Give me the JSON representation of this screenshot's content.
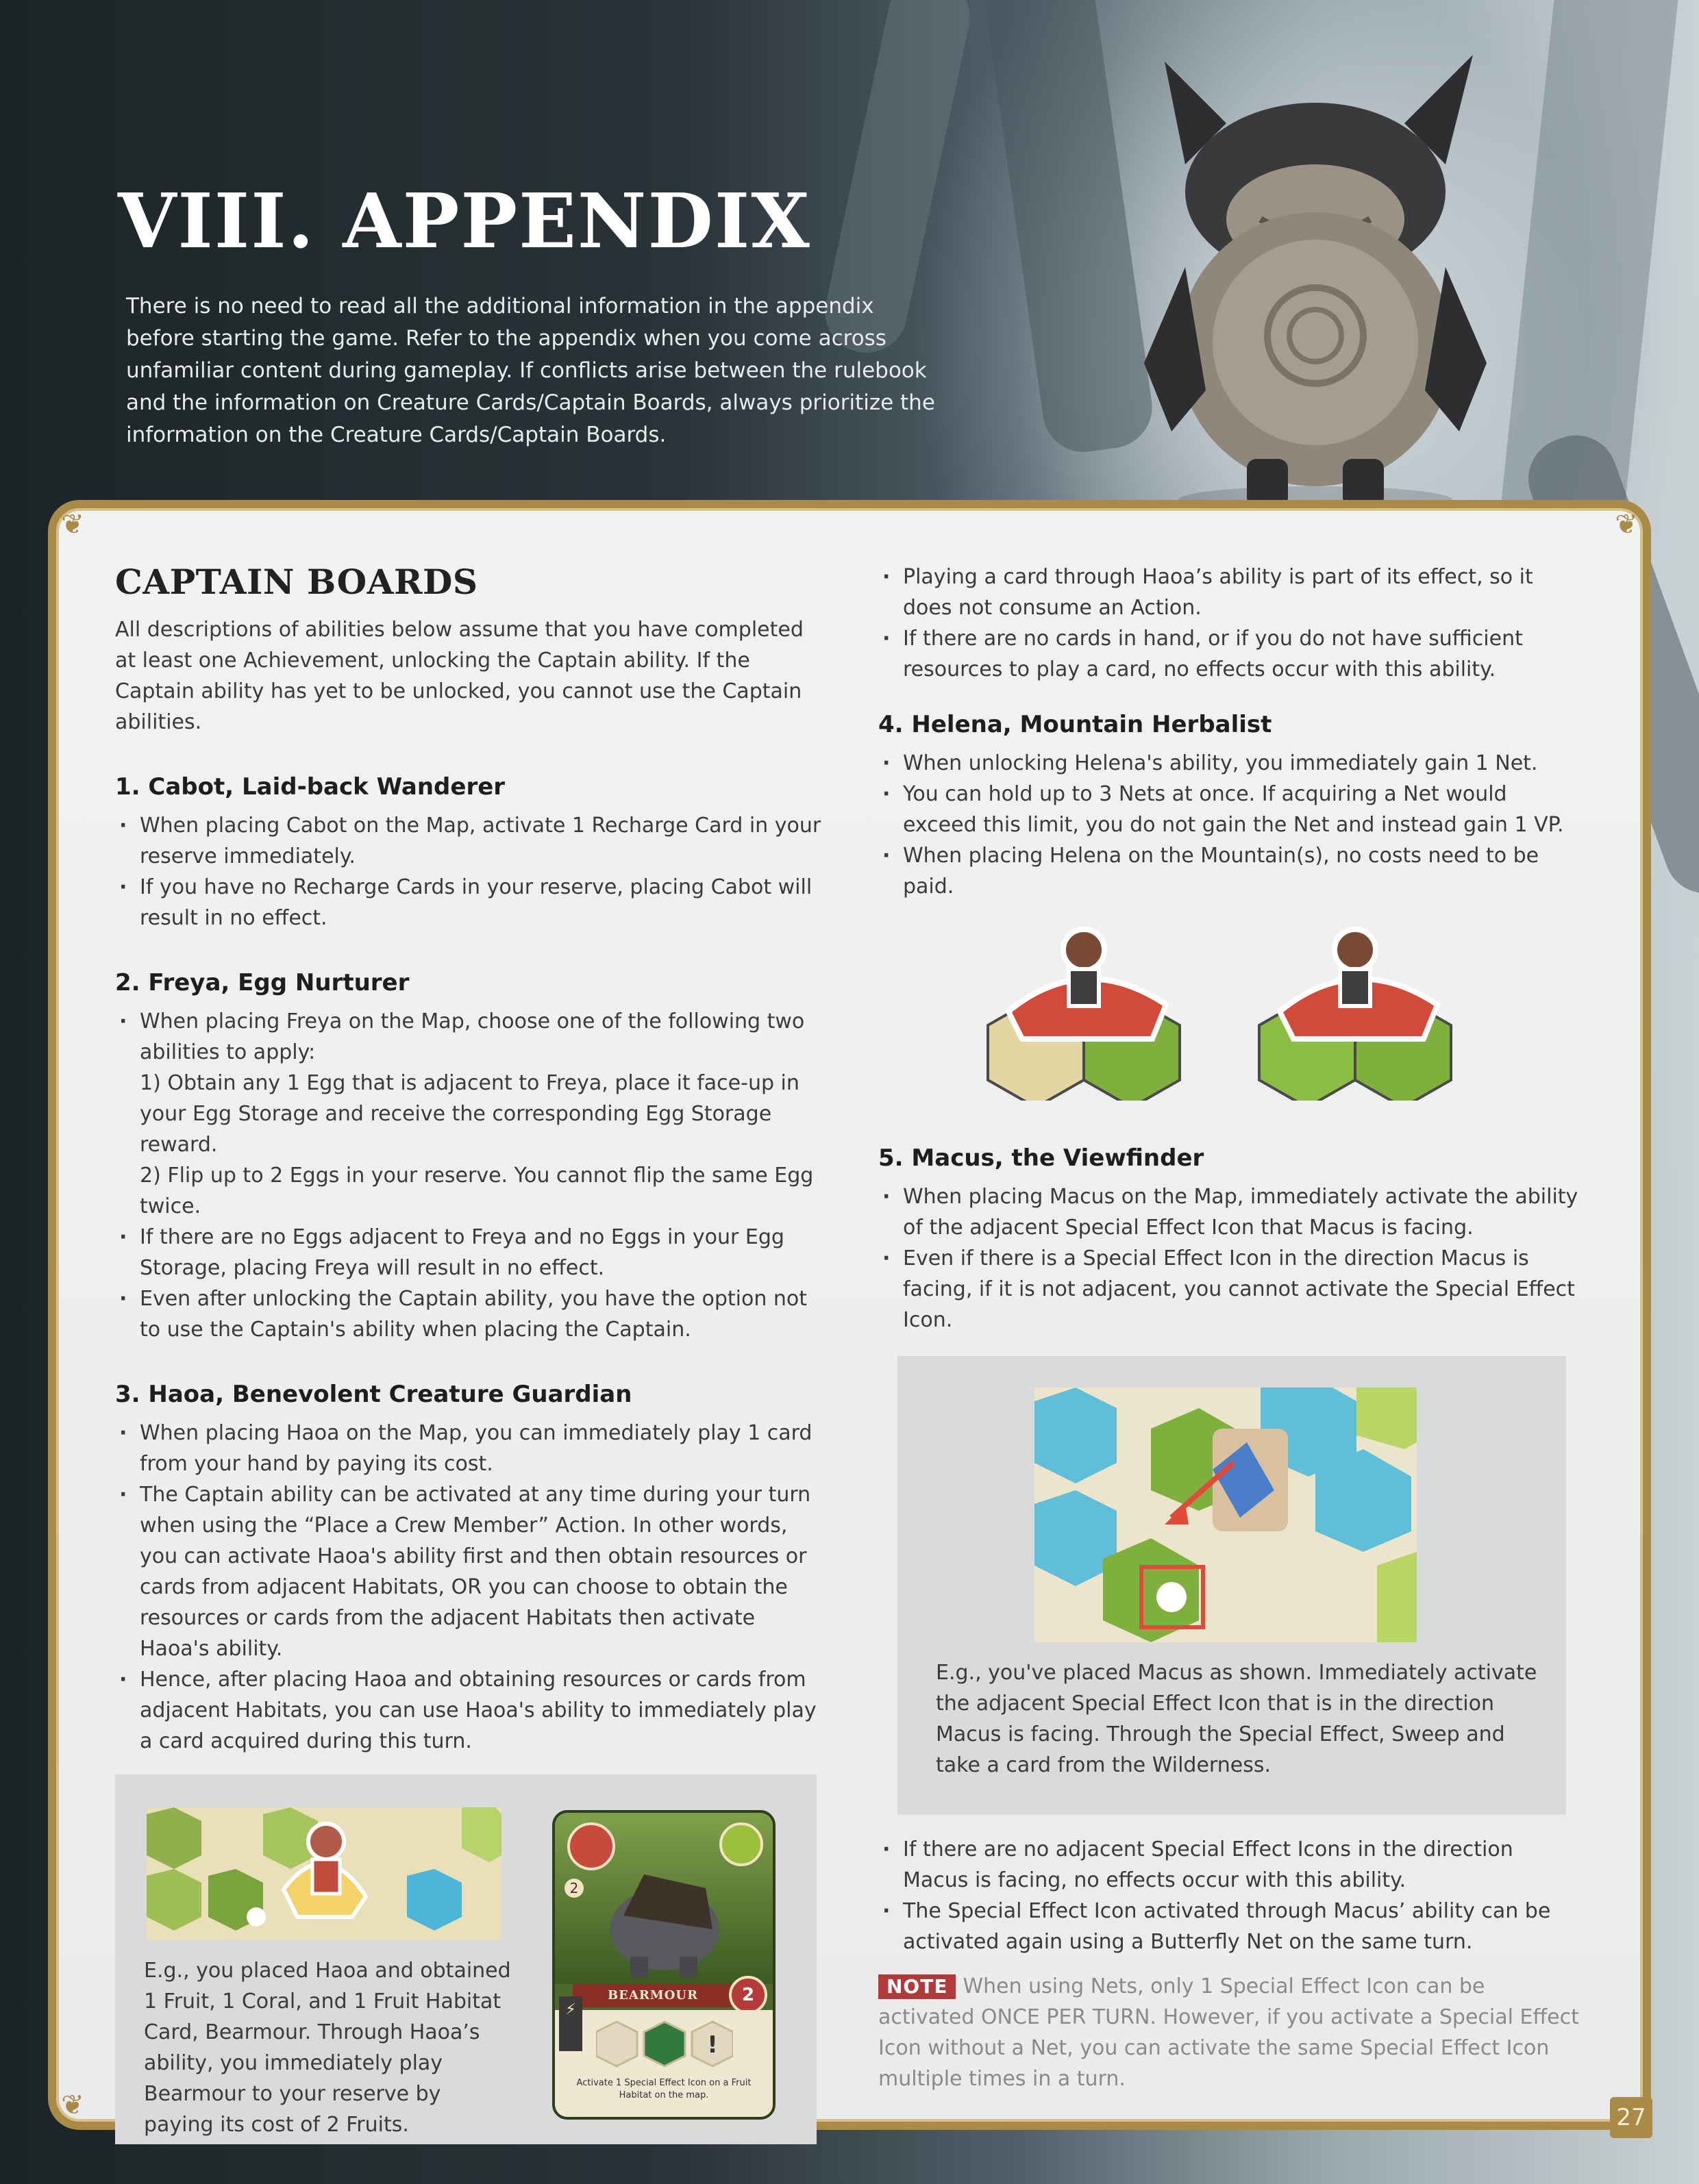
{
  "header": {
    "title": "VIII. APPENDIX",
    "intro": "There is no need to read all the additional information in the appendix before starting the game. Refer to the appendix when you come across unfamiliar content during gameplay. If conflicts arise between the rulebook and the information on Creature Cards/Captain Boards, always prioritize the information on the Creature Cards/Captain Boards."
  },
  "section": {
    "title": "CAPTAIN BOARDS",
    "lead": "All descriptions of abilities below assume that you have completed at least one Achievement, unlocking the Captain ability. If the Captain ability has yet to be unlocked, you cannot use the Captain abilities."
  },
  "captains": [
    {
      "title": "1. Cabot, Laid-back Wanderer",
      "bullets": [
        "When placing Cabot on the Map, activate 1 Recharge Card in your reserve immediately.",
        "If you have no Recharge Cards in your reserve, placing Cabot will result in no effect."
      ]
    },
    {
      "title": "2. Freya, Egg Nurturer",
      "bullets": [
        "When placing Freya on the Map, choose one of the following two abilities to apply:",
        "If there are no Eggs adjacent to Freya and no Eggs in your Egg Storage, placing Freya will result in no effect.",
        "Even after unlocking the Captain ability, you have the option not to use the Captain's ability when placing the Captain."
      ],
      "sub_items": [
        "1) Obtain any 1 Egg that is adjacent to Freya, place it face-up in your Egg Storage and receive the corresponding Egg Storage reward.",
        "2) Flip up to 2 Eggs in your reserve. You cannot flip the same Egg twice."
      ]
    },
    {
      "title": "3. Haoa, Benevolent Creature Guardian",
      "bullets": [
        "When placing Haoa on the Map, you can immediately play 1 card from your hand by paying its cost.",
        "The Captain ability can be activated at any time during your turn when using the “Place a Crew Member” Action. In other words, you can activate Haoa's ability first and then obtain resources or cards from adjacent Habitats, OR you can choose to obtain the resources or cards from the adjacent Habitats then activate Haoa's ability.",
        "Hence, after placing Haoa and obtaining resources or cards from adjacent Habitats, you can use Haoa's ability to immediately play a card acquired during this turn."
      ],
      "example": "E.g., you placed Haoa and obtained 1 Fruit, 1 Coral, and 1 Fruit Habitat Card, Bearmour. Through Haoa’s ability, you immediately play Bearmour to your reserve by paying its cost of 2 Fruits.",
      "card": {
        "name": "BEARMOUR",
        "cost": "2",
        "corner_value": "2",
        "effect": "Activate 1 Special Effect Icon on a Fruit Habitat on the map."
      },
      "bullets_continued": [
        "Playing a card through Haoa’s ability is part of its effect, so it does not consume an Action.",
        "If there are no cards in hand, or if you do not have sufficient resources to play a card, no effects occur with this ability."
      ]
    },
    {
      "title": "4. Helena, Mountain Herbalist",
      "bullets": [
        "When unlocking Helena's ability, you immediately gain 1 Net.",
        "You can hold up to 3 Nets at once. If acquiring a Net would exceed this limit, you do not gain the Net and instead gain 1 VP.",
        "When placing Helena on the Mountain(s), no costs need to be paid."
      ]
    },
    {
      "title": "5. Macus, the Viewfinder",
      "bullets": [
        "When placing Macus on the Map, immediately activate the ability of the adjacent Special Effect Icon that Macus is facing.",
        "Even if there is a Special Effect Icon in the direction Macus is facing, if it is not adjacent, you cannot activate the Special Effect Icon."
      ],
      "example": "E.g., you've placed Macus as shown. Immediately activate the adjacent Special Effect Icon that is in the direction Macus is facing. Through the Special Effect, Sweep and take a card from the Wilderness.",
      "bullets_after": [
        "If there are no adjacent Special Effect Icons in the direction Macus is facing, no effects occur with this ability.",
        "The Special Effect Icon activated through Macus’ ability can be activated again using a Butterfly Net on the same turn."
      ],
      "note_label": "NOTE",
      "note": "When using Nets, only 1 Special Effect Icon can be activated ONCE PER TURN. However, if you activate a Special Effect Icon without a Net, you can activate the same Special Effect Icon multiple times in a turn."
    }
  ],
  "page_number": "27",
  "colors": {
    "frame": "#a98a47",
    "note_badge": "#b33a3a",
    "panel": "#f1f2f3",
    "background": "#1f2629"
  }
}
